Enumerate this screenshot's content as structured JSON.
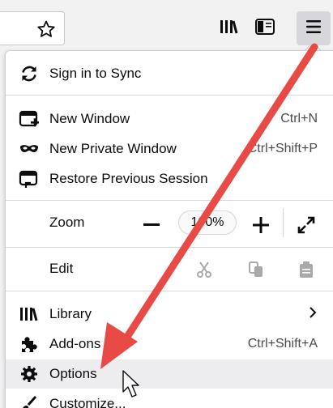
{
  "menu_items": {
    "sync": {
      "label": "Sign in to Sync"
    },
    "new_window": {
      "label": "New Window",
      "shortcut": "Ctrl+N"
    },
    "private_window": {
      "label": "New Private Window",
      "shortcut": "Ctrl+Shift+P"
    },
    "restore": {
      "label": "Restore Previous Session"
    },
    "zoom": {
      "label": "Zoom",
      "value": "100%"
    },
    "edit": {
      "label": "Edit"
    },
    "library": {
      "label": "Library"
    },
    "addons": {
      "label": "Add-ons",
      "shortcut": "Ctrl+Shift+A"
    },
    "options": {
      "label": "Options"
    },
    "customize": {
      "label": "Customize..."
    }
  },
  "colors": {
    "annotation_arrow": "#e84a45",
    "hover_bg": "#ededf0"
  },
  "icons": {
    "toolbar": [
      "star-icon",
      "library-icon",
      "sidebar-icon",
      "hamburger-menu-icon"
    ],
    "menu": [
      "sync-icon",
      "new-window-icon",
      "private-window-icon",
      "restore-session-icon",
      "library-icon",
      "puzzle-icon",
      "gear-icon",
      "brush-icon"
    ]
  }
}
